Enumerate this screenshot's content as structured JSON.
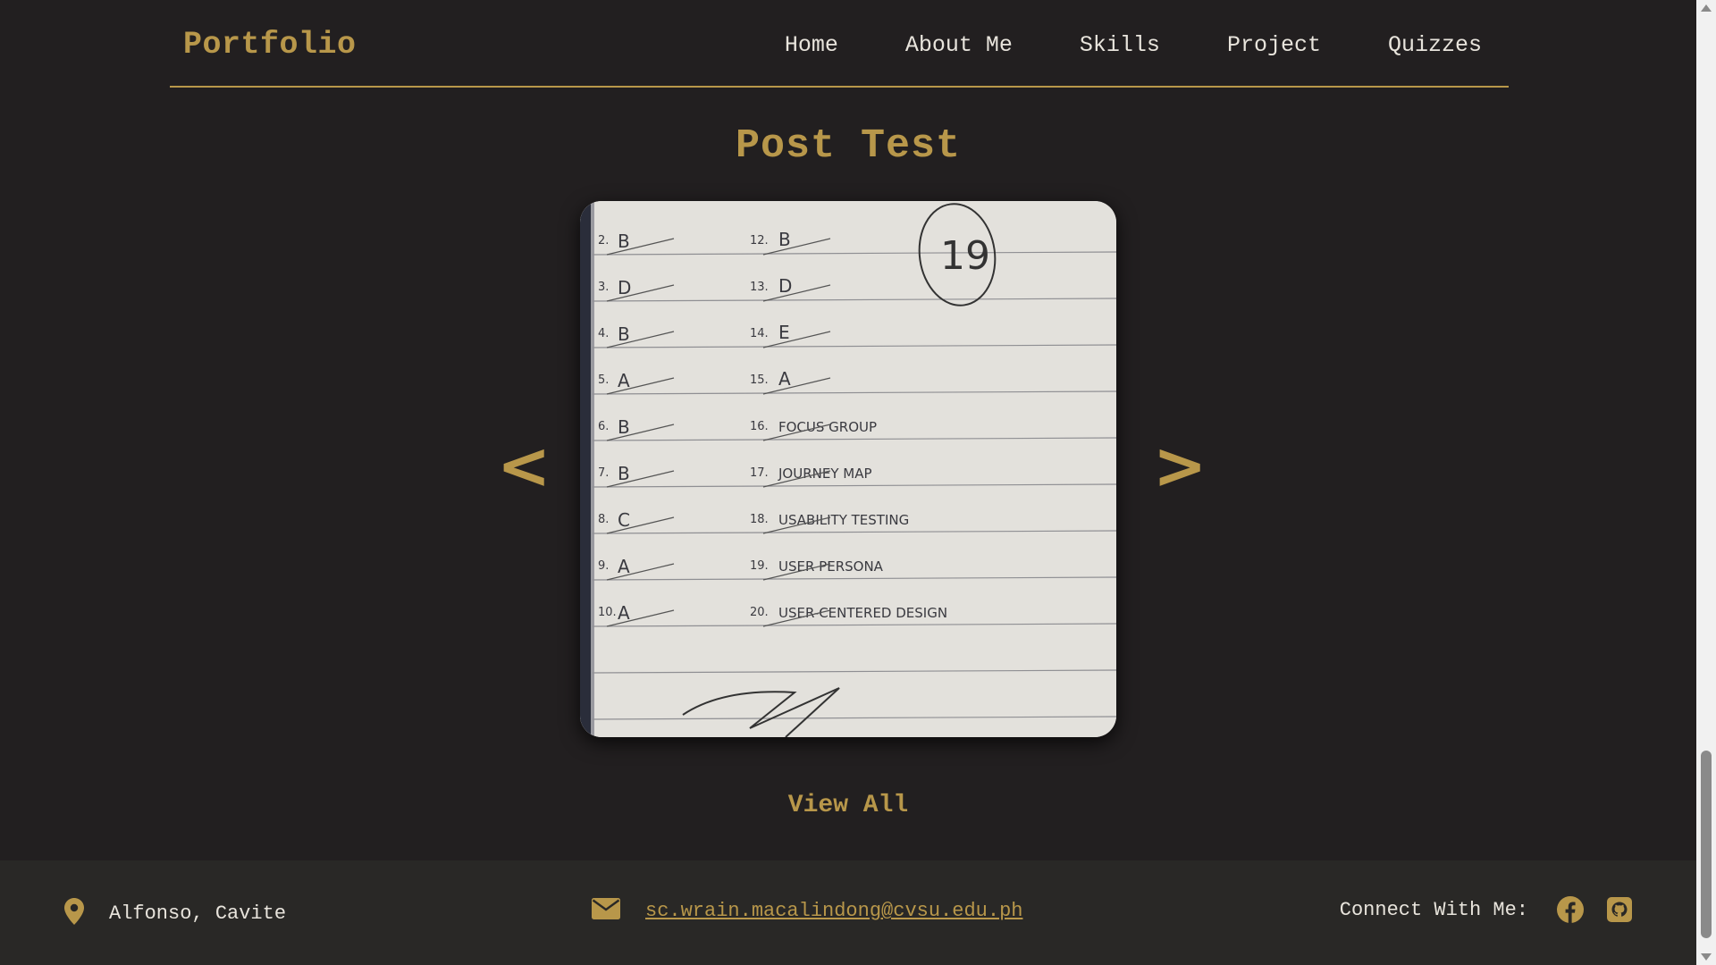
{
  "header": {
    "brand": "Portfolio",
    "nav": [
      "Home",
      "About Me",
      "Skills",
      "Project",
      "Quizzes"
    ]
  },
  "main": {
    "title": "Post Test",
    "prev_label": "<",
    "next_label": ">",
    "view_all": "View All",
    "slide": {
      "score": "19",
      "left_answers": [
        {
          "num": "2.",
          "ans": "B"
        },
        {
          "num": "3.",
          "ans": "D"
        },
        {
          "num": "4.",
          "ans": "B"
        },
        {
          "num": "5.",
          "ans": "A"
        },
        {
          "num": "6.",
          "ans": "B"
        },
        {
          "num": "7.",
          "ans": "B"
        },
        {
          "num": "8.",
          "ans": "C"
        },
        {
          "num": "9.",
          "ans": "A"
        },
        {
          "num": "10.",
          "ans": "A"
        }
      ],
      "right_answers": [
        {
          "num": "12.",
          "ans": "B"
        },
        {
          "num": "13.",
          "ans": "D"
        },
        {
          "num": "14.",
          "ans": "E"
        },
        {
          "num": "15.",
          "ans": "A"
        },
        {
          "num": "16.",
          "ans": "FOCUS GROUP"
        },
        {
          "num": "17.",
          "ans": "JOURNEY MAP"
        },
        {
          "num": "18.",
          "ans": "USABILITY TESTING"
        },
        {
          "num": "19.",
          "ans": "USER PERSONA"
        },
        {
          "num": "20.",
          "ans": "USER-CENTERED DESIGN"
        }
      ]
    }
  },
  "footer": {
    "location": "Alfonso, Cavite",
    "email": "sc.wrain.macalindong@cvsu.edu.ph",
    "connect_label": "Connect With Me:"
  },
  "icons": {
    "location": "map-pin-icon",
    "email": "envelope-icon",
    "facebook": "facebook-icon",
    "github": "github-icon"
  },
  "colors": {
    "background": "#221f20",
    "accent": "#b8974a",
    "footer": "#292826",
    "text": "#e8e4dc"
  }
}
